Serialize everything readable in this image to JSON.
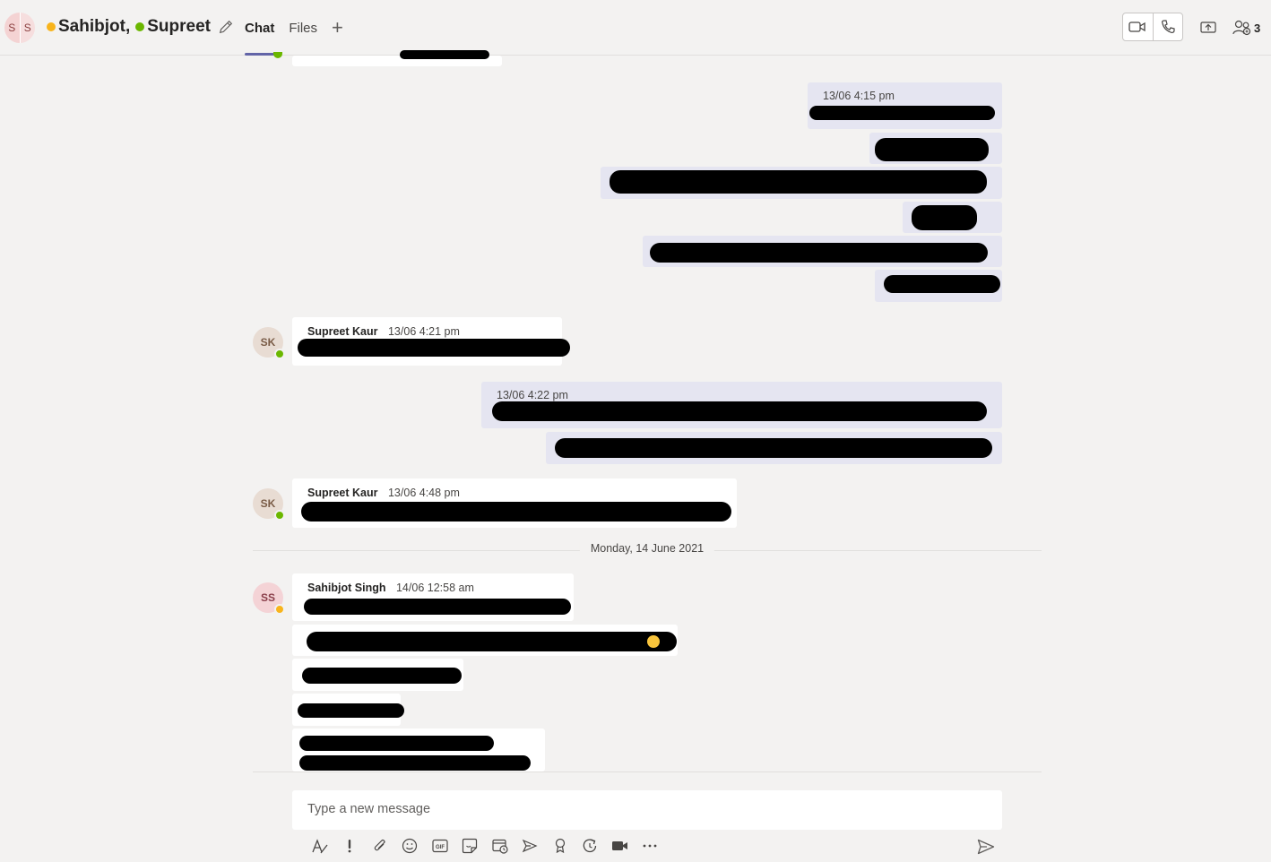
{
  "header": {
    "avatar_initials": [
      "S",
      "S"
    ],
    "title_name_1": "Sahibjot,",
    "title_name_2": "Supreet",
    "tabs": [
      {
        "label": "Chat",
        "active": true
      },
      {
        "label": "Files",
        "active": false
      }
    ],
    "add_tab_label": "+",
    "participants_count": "3"
  },
  "messages": [
    {
      "type": "mine",
      "timestamp": "13/06 4:15 pm"
    },
    {
      "type": "other",
      "author": "Supreet Kaur",
      "timestamp": "13/06 4:21 pm",
      "initials": "SK",
      "status": "available"
    },
    {
      "type": "mine",
      "timestamp": "13/06 4:22 pm"
    },
    {
      "type": "other",
      "author": "Supreet Kaur",
      "timestamp": "13/06 4:48 pm",
      "initials": "SK",
      "status": "available"
    },
    {
      "type": "other",
      "author": "Sahibjot Singh",
      "timestamp": "14/06 12:58 am",
      "initials": "SS",
      "status": "away"
    }
  ],
  "date_separator": "Monday, 14 June 2021",
  "compose": {
    "placeholder": "Type a new message"
  },
  "toolbar_icons": [
    "format-icon",
    "important-icon",
    "attach-icon",
    "emoji-icon",
    "gif-icon",
    "sticker-icon",
    "schedule-meeting-icon",
    "stream-icon",
    "praise-icon",
    "loop-icon",
    "video-clip-icon",
    "more-icon"
  ],
  "colors": {
    "accent": "#6264a7",
    "available": "#6bb700",
    "away": "#f8b41c",
    "mine_bubble": "#e5e5f1",
    "background": "#f3f2f1"
  }
}
